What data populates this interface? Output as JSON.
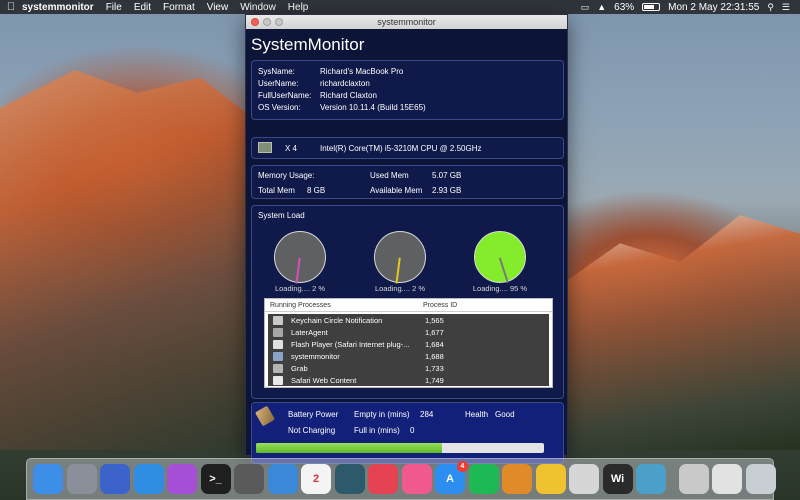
{
  "menubar": {
    "app_name": "systemmonitor",
    "menus": [
      "File",
      "Edit",
      "Format",
      "View",
      "Window",
      "Help"
    ],
    "battery_percent": "63%",
    "clock": "Mon 2 May  22:31:55"
  },
  "window": {
    "title": "systemmonitor",
    "heading": "SystemMonitor"
  },
  "system_info": {
    "sysname_label": "SysName:",
    "sysname_value": "Richard's MacBook Pro",
    "username_label": "UserName:",
    "username_value": "richardclaxton",
    "fullusername_label": "FullUserName:",
    "fullusername_value": "Richard Claxton",
    "osversion_label": "OS Version:",
    "osversion_value": "Version 10.11.4 (Build 15E65)"
  },
  "cpu": {
    "count": "X 4",
    "model": "Intel(R) Core(TM) i5-3210M CPU @ 2.50GHz"
  },
  "memory": {
    "usage_label": "Memory Usage:",
    "used_label": "Used Mem",
    "used_value": "5.07 GB",
    "total_label": "Total Mem",
    "total_value": "8 GB",
    "available_label": "Available Mem",
    "available_value": "2.93 GB"
  },
  "system_load": {
    "title": "System Load",
    "gauges": [
      {
        "label": "Loading.... 2 %",
        "percent": 2,
        "needle_color": "#d94fb8"
      },
      {
        "label": "Loading.... 2 %",
        "percent": 2,
        "needle_color": "#e2c820"
      },
      {
        "label": "Loading.... 95 %",
        "percent": 95,
        "needle_color": "#7a7a7a"
      }
    ]
  },
  "processes": {
    "col_name": "Running Processes",
    "col_pid": "Process ID",
    "rows": [
      {
        "name": "Keychain Circle Notification",
        "pid": "1,565",
        "icon_color": "#c9c9c9"
      },
      {
        "name": "LaterAgent",
        "pid": "1,677",
        "icon_color": "#a6a6a6"
      },
      {
        "name": "Flash Player (Safari Internet plug-...",
        "pid": "1,684",
        "icon_color": "#e0e0e0"
      },
      {
        "name": "systemmonitor",
        "pid": "1,688",
        "icon_color": "#8aa4c8"
      },
      {
        "name": "Grab",
        "pid": "1,733",
        "icon_color": "#b5b5b5"
      },
      {
        "name": "Safari Web Content",
        "pid": "1,749",
        "icon_color": "#e8e8e8"
      }
    ]
  },
  "battery": {
    "power_label": "Battery Power",
    "empty_label": "Empty in (mins)",
    "empty_value": "284",
    "health_label": "Health",
    "health_value": "Good",
    "status": "Not Charging",
    "full_label": "Full in (mins)",
    "full_value": "0",
    "level_fraction": 0.63
  },
  "dock": {
    "icons": [
      {
        "name": "finder",
        "color": "#3d8ee8",
        "glyph": ""
      },
      {
        "name": "launchpad",
        "color": "#8a8f99",
        "glyph": ""
      },
      {
        "name": "xcode-instruments",
        "color": "#3c63c9",
        "glyph": ""
      },
      {
        "name": "safari",
        "color": "#2f8de2",
        "glyph": ""
      },
      {
        "name": "siri-like",
        "color": "#a44fd6",
        "glyph": ""
      },
      {
        "name": "terminal",
        "color": "#1f1f1f",
        "glyph": ">_"
      },
      {
        "name": "screen",
        "color": "#5a5a5a",
        "glyph": ""
      },
      {
        "name": "xcode",
        "color": "#3a89d9",
        "glyph": ""
      },
      {
        "name": "calendar",
        "color": "#f4f4f4",
        "glyph": "2"
      },
      {
        "name": "network-app",
        "color": "#2d5a6a",
        "glyph": ""
      },
      {
        "name": "pocket",
        "color": "#e54354",
        "glyph": ""
      },
      {
        "name": "itunes",
        "color": "#f05a8f",
        "glyph": ""
      },
      {
        "name": "app-store",
        "color": "#2b8ef0",
        "glyph": "A",
        "badge": "4"
      },
      {
        "name": "spotify",
        "color": "#1db954",
        "glyph": ""
      },
      {
        "name": "sublime-or-map",
        "color": "#e08a2a",
        "glyph": ""
      },
      {
        "name": "photos",
        "color": "#f1c22f",
        "glyph": ""
      },
      {
        "name": "preview",
        "color": "#d6d6d6",
        "glyph": ""
      },
      {
        "name": "wifi-app",
        "color": "#2a2a2a",
        "glyph": "Wi"
      },
      {
        "name": "system-monitor",
        "color": "#4aa0c8",
        "glyph": ""
      },
      {
        "name": "grab",
        "color": "#c9c9c9",
        "glyph": ""
      },
      {
        "name": "documents",
        "color": "#e2e2e2",
        "glyph": ""
      },
      {
        "name": "trash",
        "color": "#c9ced4",
        "glyph": ""
      }
    ]
  }
}
